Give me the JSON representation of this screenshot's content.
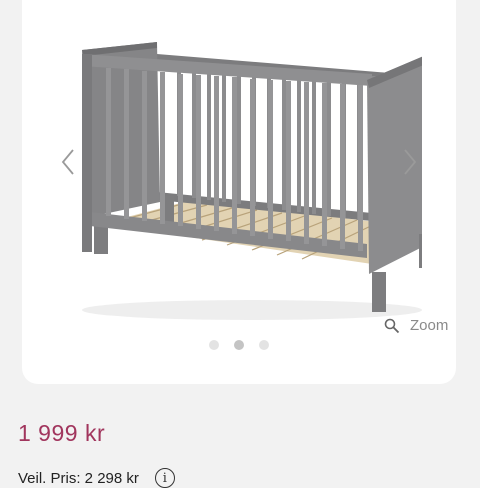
{
  "gallery": {
    "prev_icon": "chevron-left-icon",
    "next_icon": "chevron-right-icon",
    "zoom_icon": "magnifier-icon",
    "zoom_label": "Zoom",
    "dots_total": 3,
    "active_dot": 2
  },
  "product": {
    "price": "1 999 kr",
    "original_price": "Veil. Pris: 2 298 kr",
    "info_icon": "info-icon",
    "info_glyph": "i"
  },
  "colors": {
    "price": "#a1355d",
    "crib_gray": "#8c8c8e",
    "slat_wood": "#e2d3b3"
  }
}
